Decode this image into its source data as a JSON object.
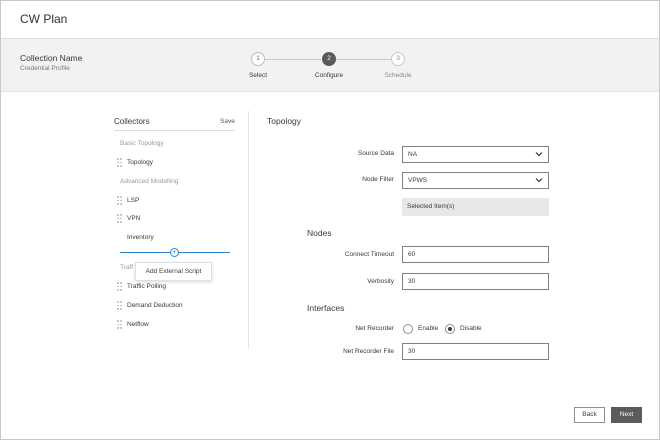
{
  "app": {
    "title": "CW Plan"
  },
  "wizard": {
    "collection_name": "Collection Name",
    "collection_sub": "Credential Profile",
    "steps": [
      {
        "number": "1",
        "label": "Select",
        "state": "done"
      },
      {
        "number": "2",
        "label": "Configure",
        "state": "active"
      },
      {
        "number": "3",
        "label": "Schedule",
        "state": "pending"
      }
    ]
  },
  "collectors": {
    "title": "Collectors",
    "save_label": "Save",
    "groups": {
      "basic": "Basic Topology",
      "advanced": "Advanced Modelling",
      "traffic_partial": "Traff"
    },
    "items": {
      "topology": "Topology",
      "lsp": "LSP",
      "vpn": "VPN",
      "inventory": "Inventory",
      "traffic_polling": "Traffic Polling",
      "demand_deduction": "Demand Deduction",
      "netflow": "Netflow"
    },
    "add_external_script": "Add External Script",
    "plus_symbol": "+"
  },
  "topology": {
    "title": "Topology",
    "source_data_label": "Source Data",
    "source_data_value": "NA",
    "node_filter_label": "Node Filter",
    "node_filter_value": "VPWS",
    "selected_items": "Selected Item(s)"
  },
  "nodes": {
    "title": "Nodes",
    "connect_timeout_label": "Connect Timeout",
    "connect_timeout_value": "60",
    "verbosity_label": "Verbosity",
    "verbosity_value": "30"
  },
  "interfaces": {
    "title": "Interfaces",
    "net_recorder_label": "Net Recorder",
    "enable_label": "Enable",
    "disable_label": "Disable",
    "selected": "Disable",
    "net_recorder_file_label": "Net Recorder File",
    "net_recorder_file_value": "30"
  },
  "footer": {
    "back_label": "Back",
    "next_label": "Next"
  },
  "colors": {
    "accent": "#2e86d6",
    "primary_button": "#5b5b5f",
    "band": "#f2f2f3"
  }
}
